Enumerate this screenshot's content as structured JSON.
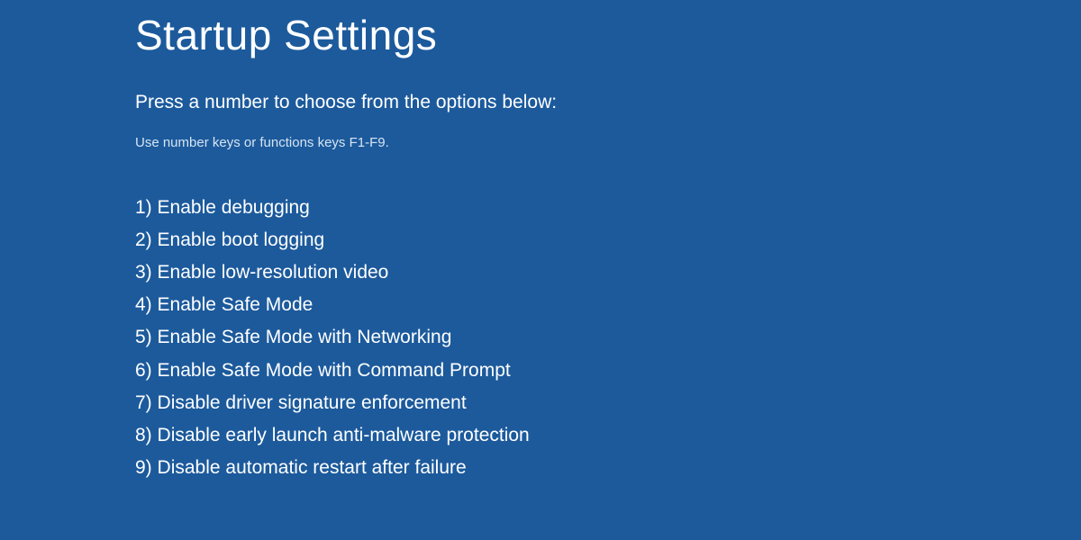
{
  "title": "Startup Settings",
  "instruction": "Press a number to choose from the options below:",
  "hint": "Use number keys or functions keys F1-F9.",
  "options": [
    {
      "number": "1)",
      "label": "Enable debugging"
    },
    {
      "number": "2)",
      "label": "Enable boot logging"
    },
    {
      "number": "3)",
      "label": "Enable low-resolution video"
    },
    {
      "number": "4)",
      "label": "Enable Safe Mode"
    },
    {
      "number": "5)",
      "label": "Enable Safe Mode with Networking"
    },
    {
      "number": "6)",
      "label": "Enable Safe Mode with Command Prompt"
    },
    {
      "number": "7)",
      "label": "Disable driver signature enforcement"
    },
    {
      "number": "8)",
      "label": "Disable early launch anti-malware protection"
    },
    {
      "number": "9)",
      "label": "Disable automatic restart after failure"
    }
  ]
}
